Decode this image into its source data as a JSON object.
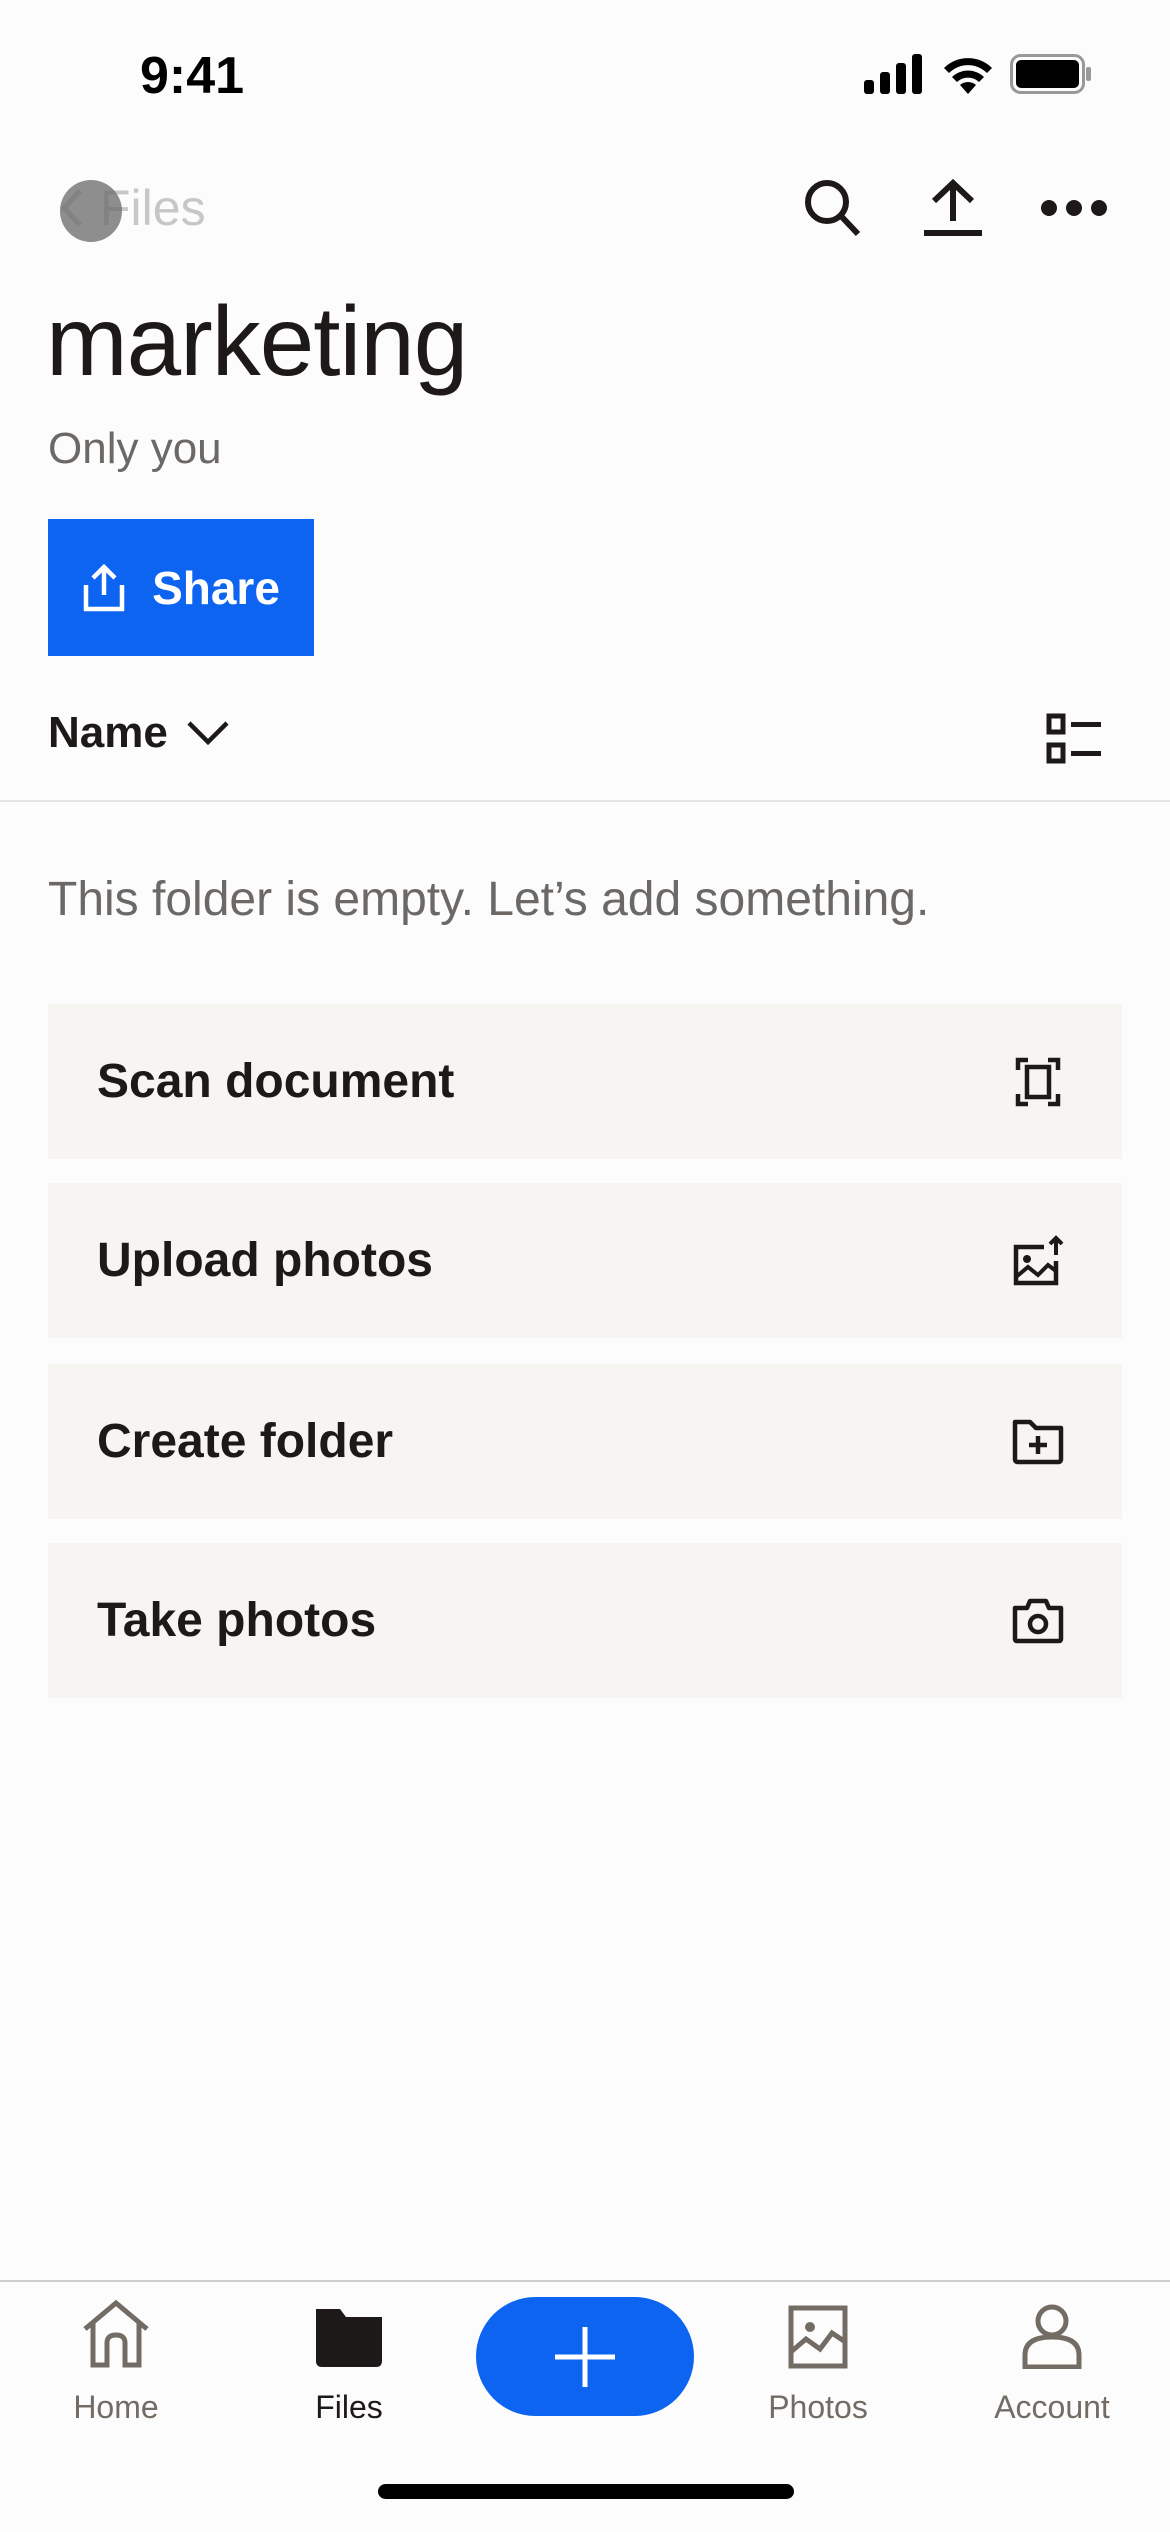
{
  "status_bar": {
    "time": "9:41",
    "icons": [
      "cellular-signal-icon",
      "wifi-icon",
      "battery-icon"
    ]
  },
  "header": {
    "back_label": "Files",
    "actions": [
      "search-icon",
      "upload-icon",
      "more-icon"
    ]
  },
  "folder": {
    "title": "marketing",
    "sharing": "Only you",
    "share_button": "Share"
  },
  "list_header": {
    "sort_label": "Name",
    "sort_icon": "chevron-down-icon",
    "view_toggle_icon": "list-view-icon"
  },
  "empty_state": {
    "message": "This folder is empty. Let’s add something.",
    "actions": [
      {
        "label": "Scan document",
        "icon": "scan-icon"
      },
      {
        "label": "Upload photos",
        "icon": "upload-photo-icon"
      },
      {
        "label": "Create folder",
        "icon": "folder-plus-icon"
      },
      {
        "label": "Take photos",
        "icon": "camera-icon"
      }
    ]
  },
  "tab_bar": {
    "tabs": [
      {
        "label": "Home",
        "icon": "home-icon",
        "active": false
      },
      {
        "label": "Files",
        "icon": "folder-icon",
        "active": true
      },
      {
        "label": "Photos",
        "icon": "photo-icon",
        "active": false
      },
      {
        "label": "Account",
        "icon": "account-icon",
        "active": false
      }
    ],
    "fab_icon": "plus-icon"
  },
  "colors": {
    "accent": "#0d64f0",
    "text_primary": "#1e1919",
    "text_secondary": "#6b6866",
    "row_background": "#f7f5f2",
    "page_background": "#fdfcfc"
  }
}
